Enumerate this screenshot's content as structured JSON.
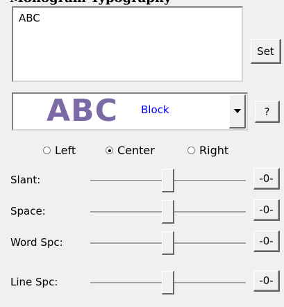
{
  "window": {
    "title": "Monogram Typography"
  },
  "text_input": {
    "value": "ABC"
  },
  "set_button": {
    "label": "Set"
  },
  "font": {
    "preview_text": "ABC",
    "preview_color": "#7b6aa6",
    "name": "Block",
    "name_color": "#0000ee",
    "dropdown_icon": "chevron-down-icon",
    "help_label": "?"
  },
  "alignment": {
    "options": [
      {
        "label": "Left",
        "selected": false
      },
      {
        "label": "Center",
        "selected": true
      },
      {
        "label": "Right",
        "selected": false
      }
    ]
  },
  "sliders": [
    {
      "label": "Slant:",
      "value": 0,
      "reset_label": "-0-"
    },
    {
      "label": "Space:",
      "value": 0,
      "reset_label": "-0-"
    },
    {
      "label": "Word Spc:",
      "value": 0,
      "reset_label": "-0-"
    },
    {
      "label": "Line Spc:",
      "value": 0,
      "reset_label": "-0-"
    }
  ]
}
